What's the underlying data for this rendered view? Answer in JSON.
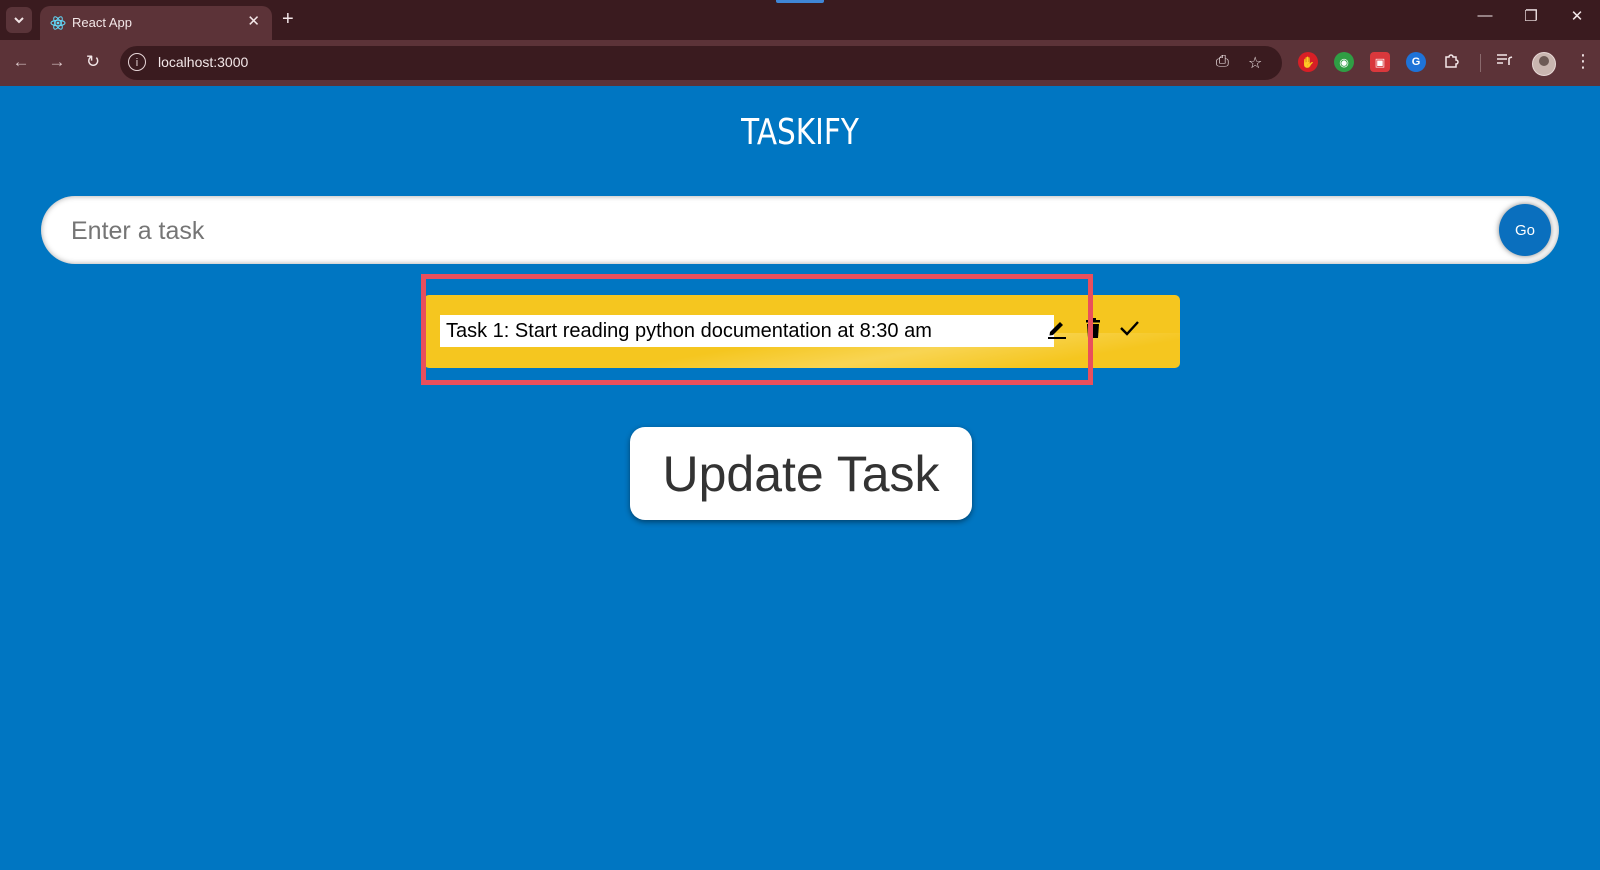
{
  "browser": {
    "tab_title": "React App",
    "url": "localhost:3000",
    "icons": {
      "tab_search": "chevron-down-icon",
      "new_tab": "+",
      "minimize": "—",
      "restore": "❐",
      "close": "✕",
      "back": "←",
      "forward": "→",
      "reload": "↻",
      "site_info": "i",
      "install": "⎙",
      "bookmark": "☆",
      "extensions": "puzzle-icon",
      "media": "media-control-icon",
      "menu": "⋮"
    },
    "colors": {
      "tabbar": "#3a1b1f",
      "toolbar": "#5c3338"
    }
  },
  "app": {
    "title": "TASKIFY",
    "input": {
      "placeholder": "Enter a task",
      "value": ""
    },
    "go_label": "Go",
    "tasks": [
      {
        "edit_value": "Task 1: Start reading python documentation at 8:30 am"
      }
    ],
    "update_label": "Update Task",
    "colors": {
      "background": "#0076c2",
      "card": "#f5c61f",
      "highlight": "#e94f5c",
      "go_button": "#0a6fbe"
    }
  }
}
